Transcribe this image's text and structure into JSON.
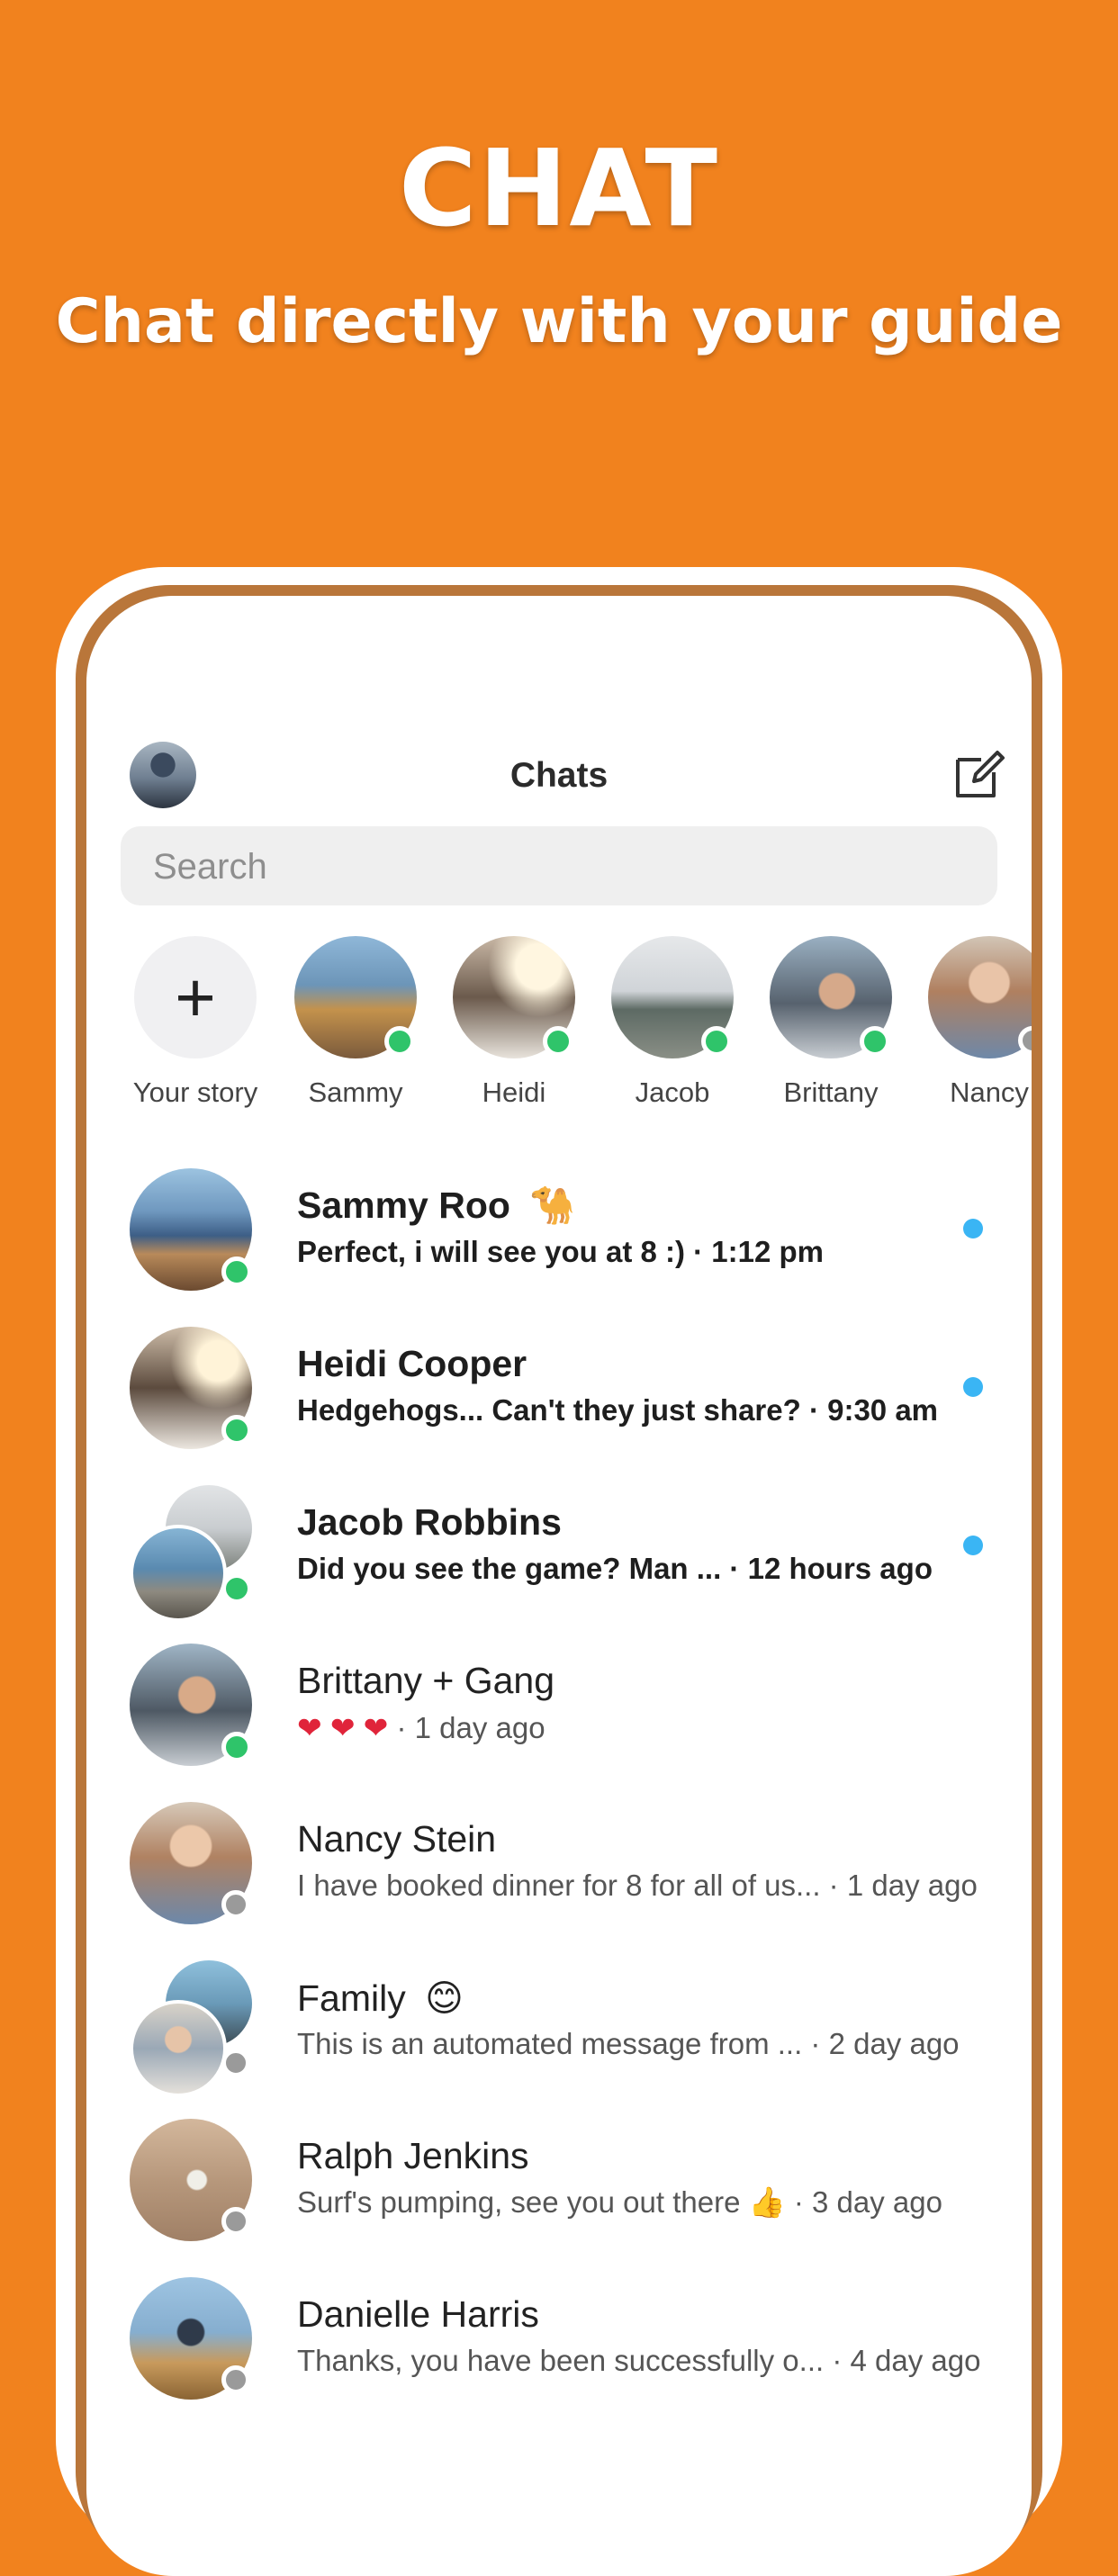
{
  "hero": {
    "title": "CHAT",
    "subtitle": "Chat directly with your guide"
  },
  "header": {
    "title": "Chats",
    "compose_icon": "compose-icon"
  },
  "search": {
    "placeholder": "Search"
  },
  "stories": [
    {
      "label": "Your story",
      "type": "add"
    },
    {
      "label": "Sammy",
      "online": true
    },
    {
      "label": "Heidi",
      "online": true
    },
    {
      "label": "Jacob",
      "online": true
    },
    {
      "label": "Brittany",
      "online": true
    },
    {
      "label": "Nancy",
      "online": false
    }
  ],
  "chats": [
    {
      "name": "Sammy Roo",
      "name_emoji": "🐪",
      "preview": "Perfect, i will see you at 8 :) · 1:12 pm",
      "unread": true,
      "online": true
    },
    {
      "name": "Heidi Cooper",
      "preview": "Hedgehogs... Can't they just share? · 9:30 am",
      "unread": true,
      "online": true
    },
    {
      "name": "Jacob Robbins",
      "preview": "Did you see the game? Man ...  · 12 hours ago",
      "unread": true,
      "online": true
    },
    {
      "name": "Brittany + Gang",
      "preview_emoji": "❤ ❤ ❤",
      "preview": " · 1 day ago",
      "unread": false,
      "online": true
    },
    {
      "name": "Nancy Stein",
      "preview": "I have booked dinner for 8 for all of us... · 1 day ago",
      "unread": false,
      "online": false
    },
    {
      "name": "Family",
      "name_emoji": "😊",
      "preview": "This is an automated message from ...  · 2 day ago",
      "unread": false,
      "online": false
    },
    {
      "name": "Ralph Jenkins",
      "preview": "Surf's pumping, see you out there 👍 · 3 day ago",
      "unread": false,
      "online": false
    },
    {
      "name": "Danielle Harris",
      "preview": "Thanks, you have been successfully o... · 4 day ago",
      "unread": false,
      "online": false
    }
  ],
  "colors": {
    "background": "#f1821e",
    "online": "#2fc46a",
    "offline": "#9a9a9a",
    "unread_dot": "#3ab5f4"
  }
}
